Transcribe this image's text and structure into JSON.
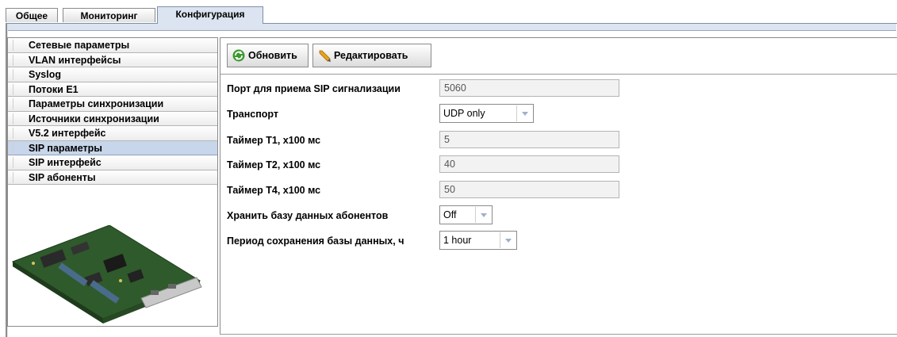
{
  "tabs": [
    {
      "label": "Общее"
    },
    {
      "label": "Мониторинг"
    },
    {
      "label": "Конфигурация"
    }
  ],
  "sidebar": {
    "items": [
      {
        "label": "Сетевые параметры"
      },
      {
        "label": "VLAN интерфейсы"
      },
      {
        "label": "Syslog"
      },
      {
        "label": "Потоки E1"
      },
      {
        "label": "Параметры синхронизации"
      },
      {
        "label": "Источники синхронизации"
      },
      {
        "label": "V5.2 интерфейс"
      },
      {
        "label": "SIP параметры"
      },
      {
        "label": "SIP интерфейс"
      },
      {
        "label": "SIP абоненты"
      }
    ],
    "selected_index": 7
  },
  "toolbar": {
    "refresh_label": "Обновить",
    "edit_label": "Редактировать"
  },
  "form": {
    "sip_port": {
      "label": "Порт для приема SIP сигнализации",
      "value": "5060"
    },
    "transport": {
      "label": "Транспорт",
      "value": "UDP only"
    },
    "timer_t1": {
      "label": "Таймер T1, x100 мс",
      "value": "5"
    },
    "timer_t2": {
      "label": "Таймер T2, x100 мс",
      "value": "40"
    },
    "timer_t4": {
      "label": "Таймер T4, x100 мс",
      "value": "50"
    },
    "store_db": {
      "label": "Хранить базу данных абонентов",
      "value": "Off"
    },
    "save_period": {
      "label": "Период сохранения базы данных, ч",
      "value": "1 hour"
    }
  },
  "colors": {
    "selected_row": "#c7d6ea",
    "active_tab": "#dbe4f0",
    "combo_arrow": "#9fb0c8",
    "refresh_icon": "#3a9a2e",
    "edit_icon": "#e8a21a"
  }
}
